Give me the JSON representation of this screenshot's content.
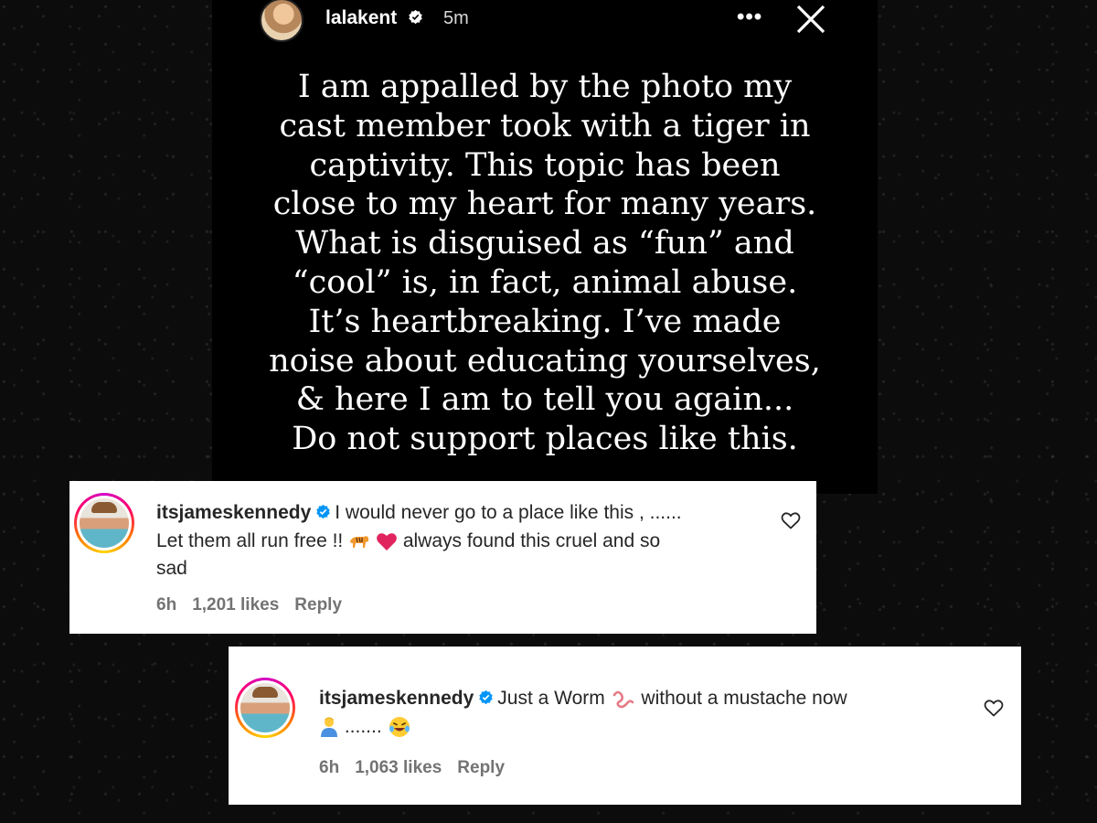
{
  "story": {
    "username": "lalakent",
    "time": "5m",
    "more_label": "•••",
    "lines": [
      "I am appalled by the photo my",
      "cast member took with a tiger in",
      "captivity. This topic has been",
      "close to my heart for many years.",
      "What is disguised as “fun” and",
      "“cool” is, in fact, animal abuse.",
      "It’s heartbreaking. I’ve made",
      "noise about educating yourselves,",
      "& here I am to tell you again...",
      "Do not support places like this."
    ]
  },
  "comments": [
    {
      "username": "itsjameskennedy",
      "text_part1": "I would never go to a place like this , ......",
      "text_part2": "Let them all run free !!",
      "text_part3": "always found this cruel and so",
      "text_part4": "sad",
      "time": "6h",
      "likes": "1,201 likes",
      "reply": "Reply"
    },
    {
      "username": "itsjameskennedy",
      "text_part1": "Just a Worm",
      "text_part2": "without a mustache now",
      "text_part3": ".......",
      "time": "6h",
      "likes": "1,063 likes",
      "reply": "Reply"
    }
  ],
  "colors": {
    "verified_blue": "#0095f6",
    "heart_red": "#e0245e",
    "meta_gray": "#737373"
  },
  "icons": [
    "verified-badge-icon",
    "more-options-icon",
    "close-icon",
    "heart-outline-icon",
    "tiger-emoji-icon",
    "red-heart-emoji-icon",
    "worm-emoji-icon",
    "person-emoji-icon",
    "laughing-emoji-icon"
  ]
}
